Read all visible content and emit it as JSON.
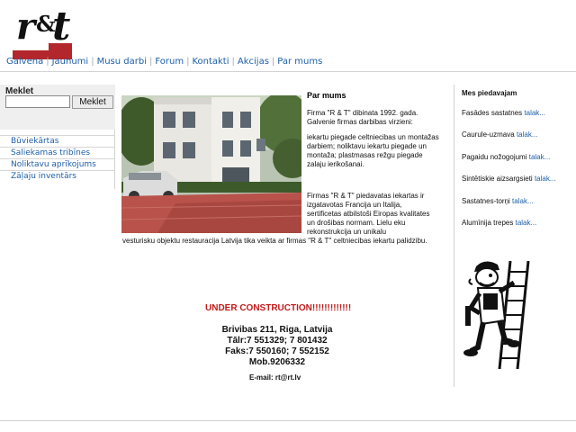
{
  "logo": {
    "r": "r",
    "amp": "&",
    "t": "t"
  },
  "nav": {
    "items": [
      "Galvena",
      "Jaunumi",
      "Musu darbi",
      "Forum",
      "Kontakti",
      "Akcijas",
      "Par mums"
    ]
  },
  "search": {
    "label": "Meklet",
    "button": "Meklet",
    "value": ""
  },
  "sidebar": {
    "items": [
      "Būviekārtas",
      "Saliekamas tribīnes",
      "Noliktavu aprīkojums",
      "Zāļaju inventārs"
    ]
  },
  "about": {
    "title": "Par mums",
    "p1": "Firma \"R & T\" dibinata 1992. gada. Galvenie firmas darbibas virzieni:",
    "p2": "iekartu piegade celtniecibas un montažas darbiem; noliktavu iekartu piegade un montaža; plastmasas režgu piegade zalaju ierikošanai.",
    "p3": "Firmas \"R & T\" piedavatas iekartas ir izgatavotas Francija un Italija, sertificetas atbilstoši Eiropas kvalitates un drošibas normam. Lielu eku rekonstrukcija un unikalu",
    "p4": "vesturisku objektu restauracija Latvija tika veikta ar firmas \"R & T\" celtniecibas iekartu palidzibu."
  },
  "notice": "UNDER CONSTRUCTION!!!!!!!!!!!!!",
  "contact": {
    "address": "Brivibas 211, Riga, Latvija",
    "tel": "Tālr:7 551329; 7 801432",
    "fax": "Faks:7 550160; 7 552152",
    "mob": "Mob.9206332",
    "email": "E-mail: rt@rt.lv"
  },
  "offers": {
    "title": "Mes piedavajam",
    "more": "talak...",
    "items": [
      "Fasādes sastatnes",
      "Caurule-uzmava",
      "Pagaidu nožogojumi",
      "Sintētiskie aizsargsieti",
      "Sastatnes-torņi",
      "Alumīnija trepes"
    ]
  },
  "colors": {
    "link": "#1d5fa8",
    "accent": "#b3262b",
    "notice": "#c21a1a"
  }
}
